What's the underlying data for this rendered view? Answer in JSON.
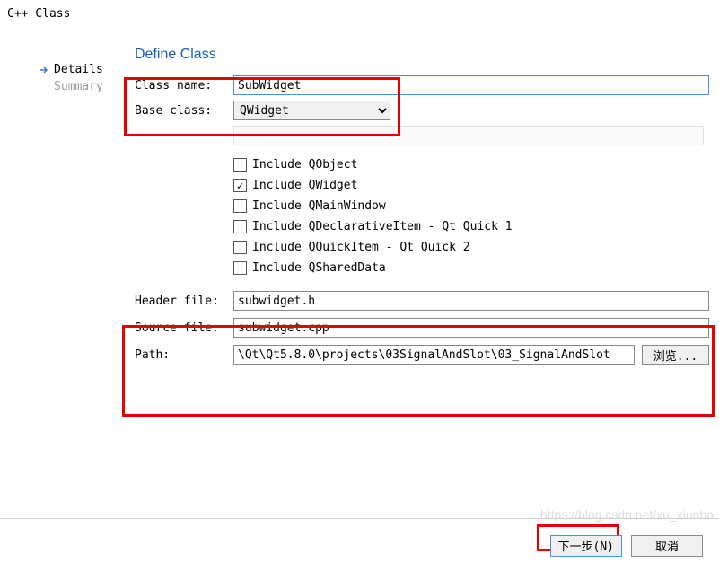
{
  "window": {
    "title": "C++ Class"
  },
  "nav": {
    "details": "Details",
    "summary": "Summary"
  },
  "heading": "Define Class",
  "form": {
    "class_name_label": "Class name:",
    "class_name_value": "SubWidget",
    "base_class_label": "Base class:",
    "base_class_value": "QWidget",
    "header_label": "Header file:",
    "header_value": "subwidget.h",
    "source_label": "Source file:",
    "source_value": "subwidget.cpp",
    "path_label": "Path:",
    "path_value": "\\Qt\\Qt5.8.0\\projects\\03SignalAndSlot\\03_SignalAndSlot",
    "browse_label": "浏览..."
  },
  "checkboxes": {
    "cb1": "Include QObject",
    "cb2": "Include QWidget",
    "cb3": "Include QMainWindow",
    "cb4": "Include QDeclarativeItem - Qt Quick 1",
    "cb5": "Include QQuickItem - Qt Quick 2",
    "cb6": "Include QSharedData"
  },
  "buttons": {
    "next": "下一步(N)",
    "cancel": "取消"
  },
  "watermark": "https://blog.csdn.net/xu_xiunba"
}
